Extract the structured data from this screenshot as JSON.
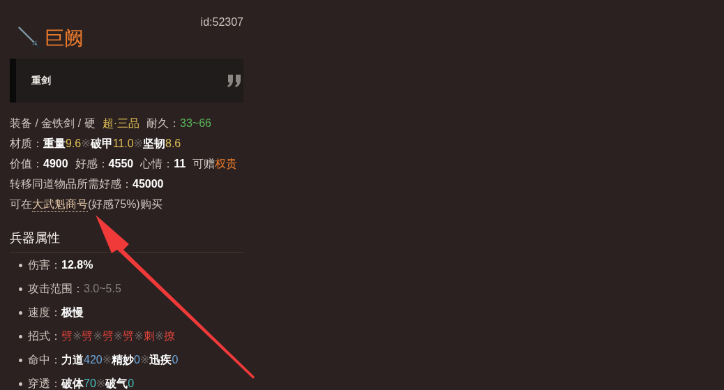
{
  "item": {
    "id": "id:52307",
    "name": "巨阙",
    "quote": "重剑"
  },
  "info_lines": [
    {
      "groups": [
        [
          {
            "text": "装备 / 金铁剑 / 硬",
            "kind": "label"
          }
        ],
        [
          {
            "text": "超·三品",
            "kind": "gold"
          }
        ],
        [
          {
            "text": "耐久：",
            "kind": "label"
          },
          {
            "text": "33~66",
            "kind": "green"
          }
        ]
      ]
    },
    {
      "groups": [
        [
          {
            "text": "材质：",
            "kind": "label"
          },
          {
            "text": "重量",
            "kind": "value"
          },
          {
            "text": "9.6",
            "kind": "gold"
          },
          {
            "text": "※",
            "kind": "sep"
          },
          {
            "text": "破甲",
            "kind": "value"
          },
          {
            "text": "11.0",
            "kind": "gold"
          },
          {
            "text": "※",
            "kind": "sep"
          },
          {
            "text": "坚韧",
            "kind": "value"
          },
          {
            "text": "8.6",
            "kind": "gold"
          }
        ]
      ]
    },
    {
      "groups": [
        [
          {
            "text": "价值：",
            "kind": "label"
          },
          {
            "text": "4900",
            "kind": "value"
          }
        ],
        [
          {
            "text": "好感：",
            "kind": "label"
          },
          {
            "text": "4550",
            "kind": "value"
          }
        ],
        [
          {
            "text": "心情：",
            "kind": "label"
          },
          {
            "text": "11",
            "kind": "value"
          }
        ],
        [
          {
            "text": "可赠",
            "kind": "label"
          },
          {
            "text": "权贵",
            "kind": "orange"
          }
        ]
      ]
    },
    {
      "groups": [
        [
          {
            "text": "转移同道物品所需好感：",
            "kind": "label"
          },
          {
            "text": "45000",
            "kind": "value"
          }
        ]
      ]
    },
    {
      "groups": [
        [
          {
            "text": "可在",
            "kind": "label"
          },
          {
            "text": "大武魁商号",
            "kind": "link"
          },
          {
            "text": "(好感75%)购买",
            "kind": "label"
          }
        ]
      ]
    }
  ],
  "section": {
    "title": "兵器属性",
    "attributes": [
      {
        "groups": [
          [
            {
              "text": "伤害：",
              "kind": "label"
            },
            {
              "text": "12.8%",
              "kind": "value"
            }
          ]
        ]
      },
      {
        "groups": [
          [
            {
              "text": "攻击范围：",
              "kind": "label"
            },
            {
              "text": "3.0~5.5",
              "kind": "grey"
            }
          ]
        ]
      },
      {
        "groups": [
          [
            {
              "text": "速度：",
              "kind": "label"
            },
            {
              "text": "极慢",
              "kind": "value"
            }
          ]
        ]
      },
      {
        "groups": [
          [
            {
              "text": "招式：",
              "kind": "label"
            },
            {
              "text": "劈",
              "kind": "red"
            },
            {
              "text": "※",
              "kind": "sep"
            },
            {
              "text": "劈",
              "kind": "red"
            },
            {
              "text": "※",
              "kind": "sep"
            },
            {
              "text": "劈",
              "kind": "red"
            },
            {
              "text": "※",
              "kind": "sep"
            },
            {
              "text": "劈",
              "kind": "red"
            },
            {
              "text": "※",
              "kind": "sep"
            },
            {
              "text": "刺",
              "kind": "red"
            },
            {
              "text": "※",
              "kind": "sep"
            },
            {
              "text": "撩",
              "kind": "red"
            }
          ]
        ]
      },
      {
        "groups": [
          [
            {
              "text": "命中：",
              "kind": "label"
            },
            {
              "text": "力道",
              "kind": "value"
            },
            {
              "text": "420",
              "kind": "blue"
            },
            {
              "text": "※",
              "kind": "sep"
            },
            {
              "text": "精妙",
              "kind": "value"
            },
            {
              "text": "0",
              "kind": "blue"
            },
            {
              "text": "※",
              "kind": "sep"
            },
            {
              "text": "迅疾",
              "kind": "value"
            },
            {
              "text": "0",
              "kind": "blue"
            }
          ]
        ]
      },
      {
        "groups": [
          [
            {
              "text": "穿透：",
              "kind": "label"
            },
            {
              "text": "破体",
              "kind": "value"
            },
            {
              "text": "70",
              "kind": "teal"
            },
            {
              "text": "※",
              "kind": "sep"
            },
            {
              "text": "破气",
              "kind": "value"
            },
            {
              "text": "0",
              "kind": "teal"
            }
          ]
        ]
      }
    ]
  }
}
